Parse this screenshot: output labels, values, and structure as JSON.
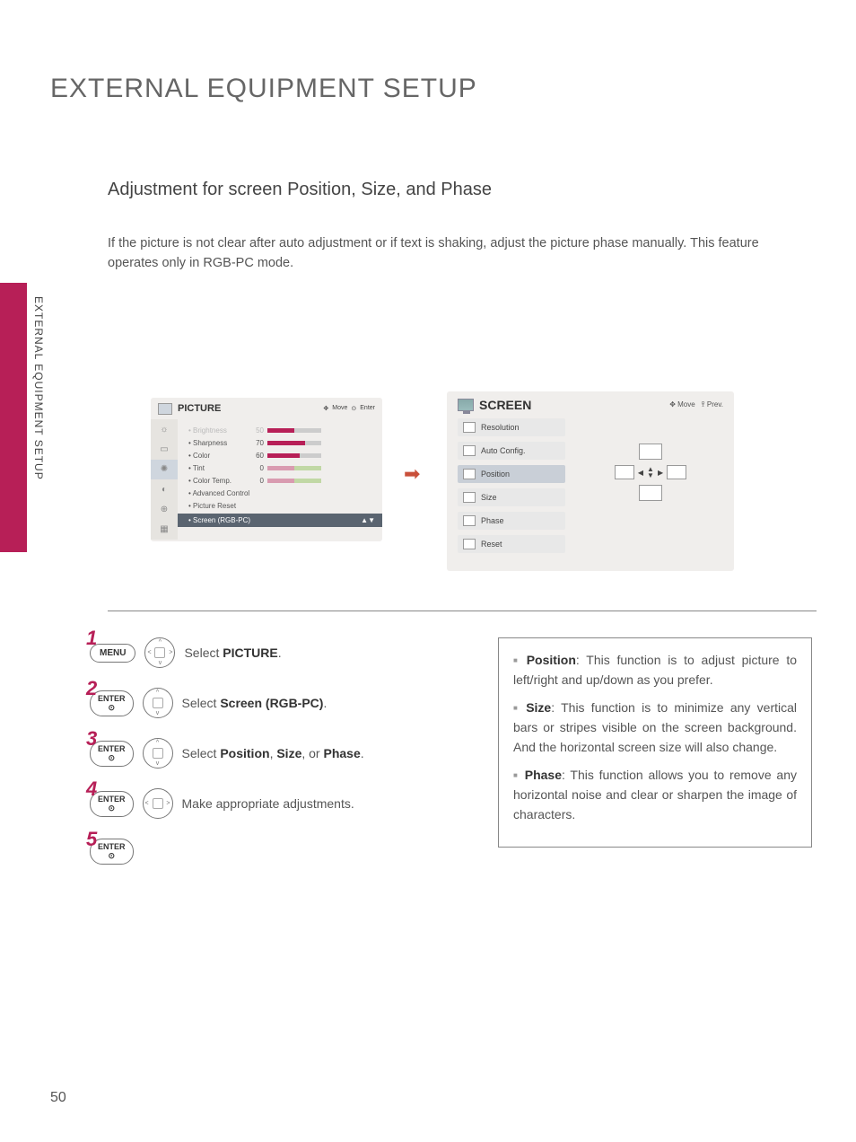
{
  "page_title": "EXTERNAL EQUIPMENT SETUP",
  "side_label": "EXTERNAL EQUIPMENT SETUP",
  "page_number": "50",
  "section_heading": "Adjustment for screen Position, Size, and Phase",
  "intro_text": "If the picture is not clear after auto adjustment or if text is shaking, adjust the picture phase manually. This feature operates only in RGB-PC mode.",
  "osd_picture": {
    "title": "PICTURE",
    "nav_move": "Move",
    "nav_enter": "Enter",
    "rows": [
      {
        "label": "• Brightness",
        "value": "50",
        "fill": 50,
        "dim": true
      },
      {
        "label": "• Sharpness",
        "value": "70",
        "fill": 70
      },
      {
        "label": "• Color",
        "value": "60",
        "fill": 60
      },
      {
        "label": "• Tint",
        "value": "0",
        "tint": true
      },
      {
        "label": "• Color Temp.",
        "value": "0",
        "tint": true
      }
    ],
    "adv": "• Advanced Control",
    "reset": "• Picture Reset",
    "selected": "• Screen (RGB-PC)"
  },
  "osd_screen": {
    "title": "SCREEN",
    "nav_move": "Move",
    "nav_prev": "Prev.",
    "items": [
      "Resolution",
      "Auto Config.",
      "Position",
      "Size",
      "Phase",
      "Reset"
    ],
    "selected_index": 2
  },
  "steps": [
    {
      "num": "1",
      "btn": "MENU",
      "dpad": "lr",
      "text_pre": "Select ",
      "text_bold": "PICTURE",
      "text_post": "."
    },
    {
      "num": "2",
      "btn": "ENTER",
      "sub": "⊙",
      "dpad": "ud",
      "text_pre": "Select ",
      "text_bold": "Screen (RGB-PC)",
      "text_post": "."
    },
    {
      "num": "3",
      "btn": "ENTER",
      "sub": "⊙",
      "dpad": "ud",
      "text_pre": "Select ",
      "text_bold": "Position",
      "text_mid": ", ",
      "text_bold2": "Size",
      "text_mid2": ", or ",
      "text_bold3": "Phase",
      "text_post": "."
    },
    {
      "num": "4",
      "btn": "ENTER",
      "sub": "⊙",
      "dpad": "lr",
      "text_pre": "Make appropriate adjustments."
    },
    {
      "num": "5",
      "btn": "ENTER",
      "sub": "⊙"
    }
  ],
  "info": [
    {
      "bold": "Position",
      "text": ": This function is to adjust picture to left/right and up/down as you prefer."
    },
    {
      "bold": "Size",
      "text": ": This function is to minimize any vertical bars or stripes visible on the screen background. And the horizontal screen size will also change."
    },
    {
      "bold": "Phase",
      "text": ": This function allows you to remove any horizontal noise and clear or sharpen the image of characters."
    }
  ]
}
